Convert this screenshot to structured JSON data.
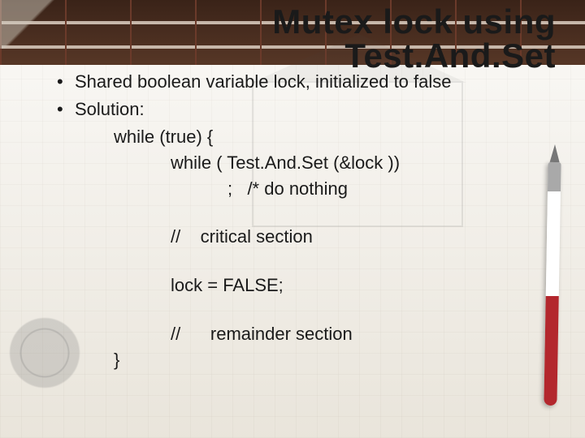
{
  "title": {
    "line1": "Mutex lock using",
    "line2": "Test.And.Set"
  },
  "bullets": {
    "b1": "Shared boolean variable lock, initialized to false",
    "b2": "Solution:"
  },
  "code": {
    "l1": "while (true) {",
    "l2": "while ( Test.And.Set (&lock ))",
    "l3": ";   /* do nothing",
    "l4": "//    critical section",
    "l5": "lock = FALSE;",
    "l6": "//      remainder section",
    "l7": "}"
  }
}
